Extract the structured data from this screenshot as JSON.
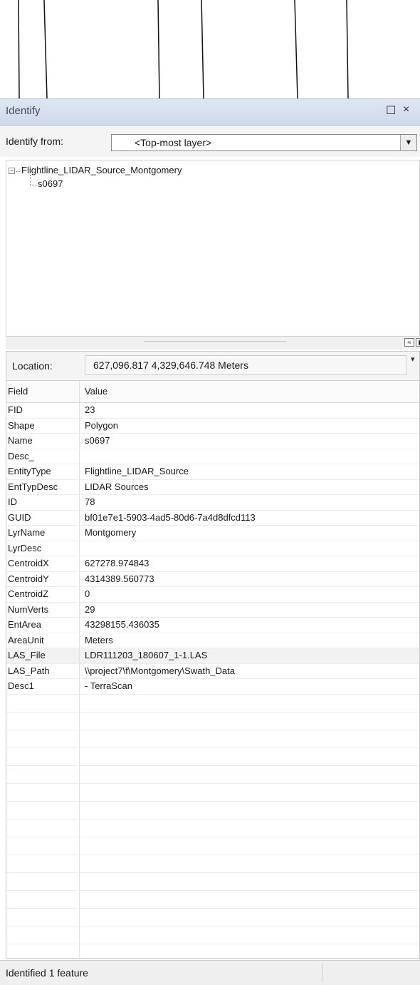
{
  "window": {
    "title": "Identify",
    "maximize_glyph": "☐",
    "close_glyph": "×"
  },
  "identify_from": {
    "label": "Identify from:",
    "selected": "<Top-most layer>",
    "dropdown_glyph": "▼"
  },
  "tree": {
    "layer": "Flightline_LIDAR_Source_Montgomery",
    "feature": "s0697",
    "expander_glyph": "−"
  },
  "location": {
    "label": "Location:",
    "value": "627,096.817  4,329,646.748 Meters"
  },
  "table": {
    "header_field": "Field",
    "header_value": "Value",
    "rows": [
      {
        "field": "FID",
        "value": "23"
      },
      {
        "field": "Shape",
        "value": "Polygon"
      },
      {
        "field": "Name",
        "value": "s0697"
      },
      {
        "field": "Desc_",
        "value": ""
      },
      {
        "field": "EntityType",
        "value": "Flightline_LIDAR_Source"
      },
      {
        "field": "EntTypDesc",
        "value": "LIDAR Sources"
      },
      {
        "field": "ID",
        "value": "78"
      },
      {
        "field": "GUID",
        "value": "bf01e7e1-5903-4ad5-80d6-7a4d8dfcd113"
      },
      {
        "field": "LyrName",
        "value": "Montgomery"
      },
      {
        "field": "LyrDesc",
        "value": ""
      },
      {
        "field": "CentroidX",
        "value": "627278.974843"
      },
      {
        "field": "CentroidY",
        "value": "4314389.560773"
      },
      {
        "field": "CentroidZ",
        "value": "0"
      },
      {
        "field": "NumVerts",
        "value": "29"
      },
      {
        "field": "EntArea",
        "value": "43298155.436035"
      },
      {
        "field": "AreaUnit",
        "value": "Meters"
      },
      {
        "field": "LAS_File",
        "value": "LDR111203_180607_1-1.LAS"
      },
      {
        "field": "LAS_Path",
        "value": "\\\\project7\\f\\Montgomery\\Swath_Data"
      },
      {
        "field": "Desc1",
        "value": "- TerraScan"
      }
    ]
  },
  "status": {
    "text": "Identified 1 feature"
  }
}
